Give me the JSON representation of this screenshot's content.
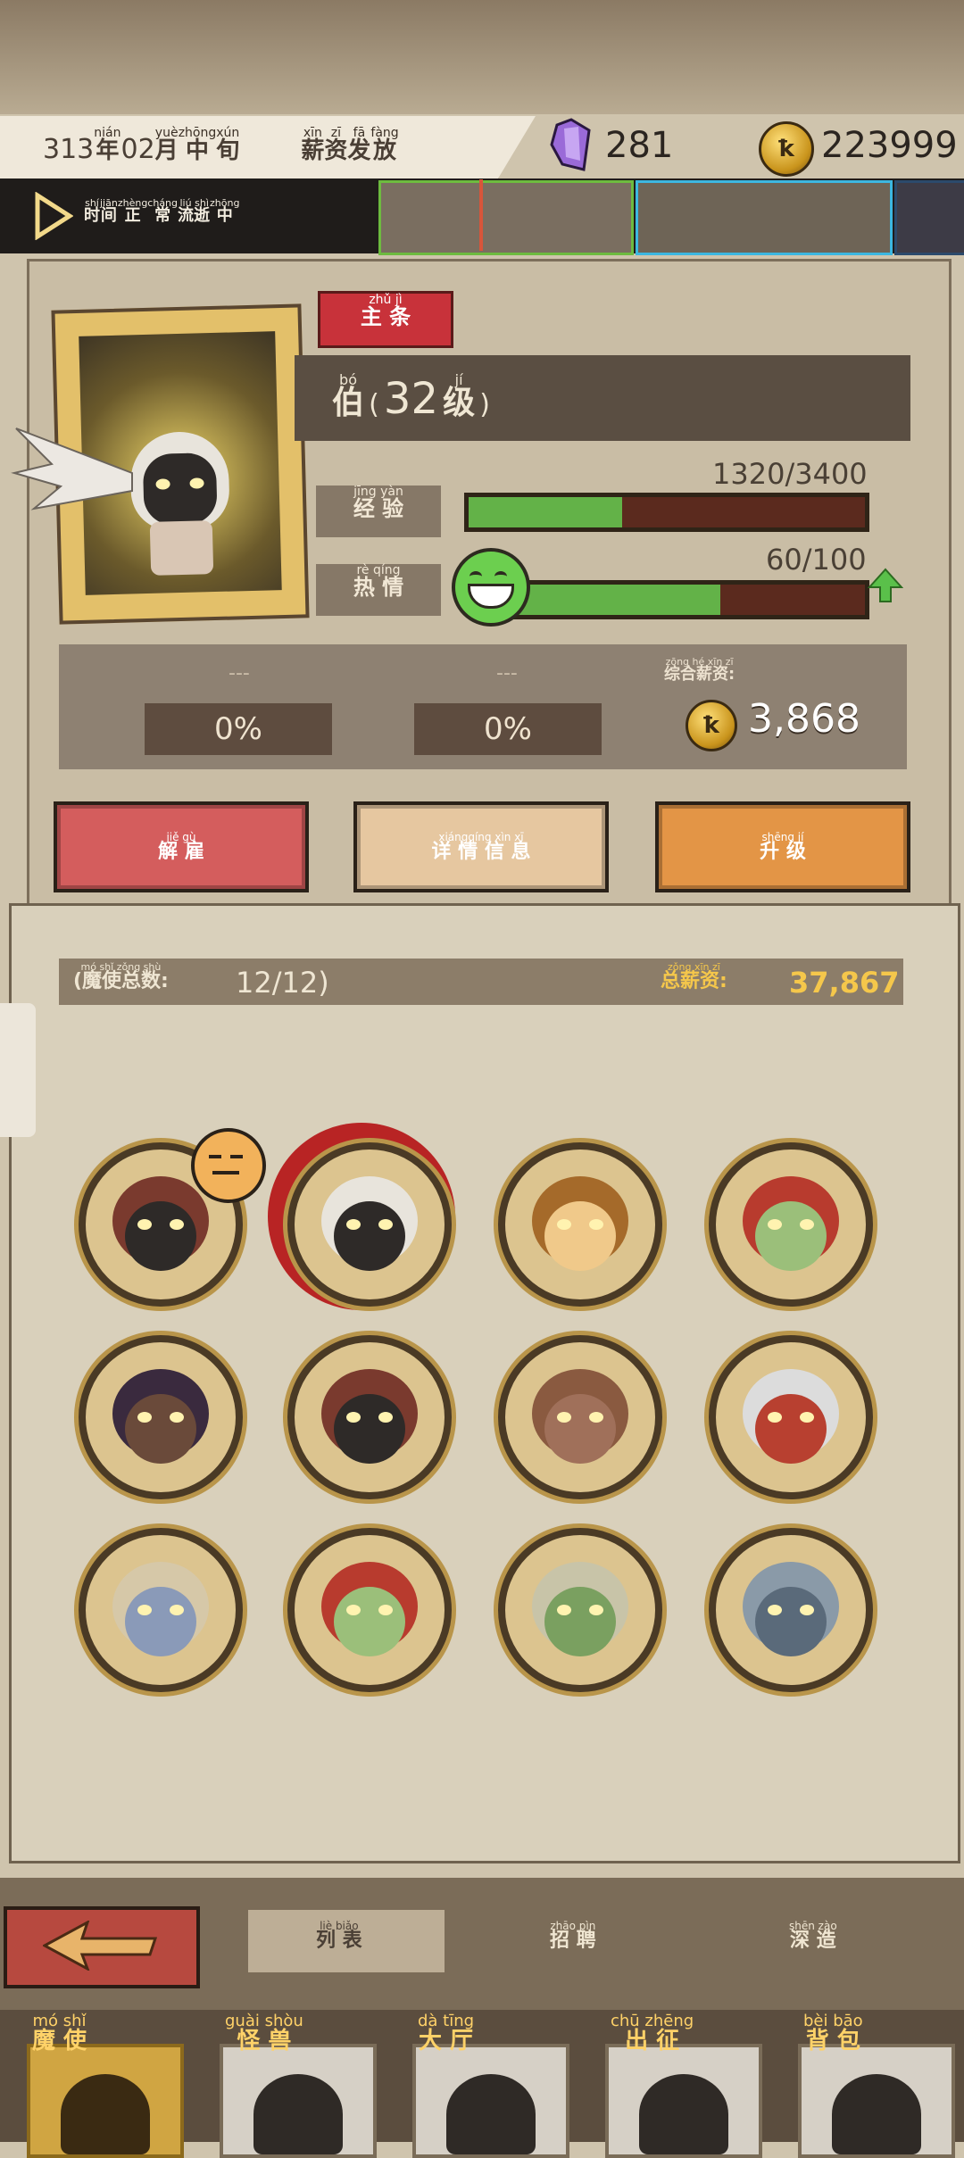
{
  "header": {
    "date_num": "313",
    "date_parts": [
      {
        "hz": "年",
        "py": "nián"
      },
      {
        "hz": "月",
        "py": "yuè"
      },
      {
        "hz": "中",
        "py": "zhōng"
      },
      {
        "hz": "旬",
        "py": "xún"
      }
    ],
    "month": "02",
    "event": [
      {
        "hz": "薪",
        "py": "xīn"
      },
      {
        "hz": "资",
        "py": "zī"
      },
      {
        "hz": "发",
        "py": "fā"
      },
      {
        "hz": "放",
        "py": "fàng"
      }
    ],
    "crystals": "281",
    "coins": "223999",
    "flow_status": [
      {
        "hz": "时",
        "py": "shí"
      },
      {
        "hz": "间",
        "py": "jiān"
      },
      {
        "hz": "正",
        "py": "zhèng"
      },
      {
        "hz": "常",
        "py": "cháng"
      },
      {
        "hz": "流",
        "py": "liú"
      },
      {
        "hz": "逝",
        "py": "shì"
      },
      {
        "hz": "中",
        "py": "zhōng"
      }
    ]
  },
  "character": {
    "tag": {
      "hz": "主 条",
      "py": "zhǔ jì"
    },
    "rank": {
      "hz": "伯",
      "py": "bó"
    },
    "level": "32",
    "level_unit": {
      "hz": "级",
      "py": "jí"
    },
    "exp_label": {
      "hz": "经 验",
      "py": "jīng yàn"
    },
    "exp_value": "1320/3400",
    "exp_fraction": 0.388,
    "passion_label": {
      "hz": "热 情",
      "py": "rè qíng"
    },
    "passion_value": "60/100",
    "passion_fraction": 0.6,
    "stat1_value": "0%",
    "stat2_value": "0%",
    "stat_dash": "---",
    "salary_label": {
      "hz": "综合薪资:",
      "py": "zōng hé xīn zī"
    },
    "salary_value": "3,868"
  },
  "actions": [
    {
      "hz": "解 雇",
      "py": "jiě gù"
    },
    {
      "hz": "详 情 信 息",
      "py": "xiángqíng xìn xī"
    },
    {
      "hz": "升 级",
      "py": "shēng jí"
    }
  ],
  "roster": {
    "count_label": {
      "hz": "(魔使总数:",
      "py": "mó shǐ zǒng shù"
    },
    "count_value": "12/12)",
    "total_label": {
      "hz": "总薪资:",
      "py": "zǒng xīn zī"
    },
    "total_value": "37,867",
    "heroes": [
      {
        "name": "hero-1",
        "skin": "#2e2a28",
        "hair": "#7a3a2e"
      },
      {
        "name": "hero-2",
        "skin": "#2e2a28",
        "hair": "#e8e4dc"
      },
      {
        "name": "hero-3",
        "skin": "#f0c98a",
        "hair": "#a56a2a"
      },
      {
        "name": "hero-4",
        "skin": "#9bbf7a",
        "hair": "#b83b2e"
      },
      {
        "name": "hero-5",
        "skin": "#6a4a3a",
        "hair": "#3a2a3e"
      },
      {
        "name": "hero-6",
        "skin": "#2e2a28",
        "hair": "#7a3a2e"
      },
      {
        "name": "hero-7",
        "skin": "#a0705a",
        "hair": "#8a5a40"
      },
      {
        "name": "hero-8",
        "skin": "#b84030",
        "hair": "#dcdcdc"
      },
      {
        "name": "hero-9",
        "skin": "#8a9ab8",
        "hair": "#d6c8a8"
      },
      {
        "name": "hero-10",
        "skin": "#9bbf7a",
        "hair": "#b83b2e"
      },
      {
        "name": "hero-11",
        "skin": "#7aa060",
        "hair": "#c8c4a8"
      },
      {
        "name": "hero-12",
        "skin": "#5a6a7a",
        "hair": "#8a9aa8"
      }
    ]
  },
  "subnav": [
    {
      "hz": "列 表",
      "py": "liè biǎo"
    },
    {
      "hz": "招 聘",
      "py": "zhāo pìn"
    },
    {
      "hz": "深 造",
      "py": "shēn zào"
    }
  ],
  "bottomnav": [
    {
      "hz": "魔 使",
      "py": "mó shǐ",
      "icon": "skull-icon"
    },
    {
      "hz": "怪 兽",
      "py": "guài shòu",
      "icon": "monster-icon"
    },
    {
      "hz": "大 厅",
      "py": "dà tīng",
      "icon": "hall-icon"
    },
    {
      "hz": "出 征",
      "py": "chū zhēng",
      "icon": "expedition-icon"
    },
    {
      "hz": "背 包",
      "py": "bèi bāo",
      "icon": "backpack-icon"
    }
  ],
  "colors": {
    "exp_fill": "#63b248",
    "bar_bg": "#5b2a1e",
    "salary_gold": "#f5c74b",
    "danger": "#d45d5d",
    "upgrade": "#e39546"
  }
}
